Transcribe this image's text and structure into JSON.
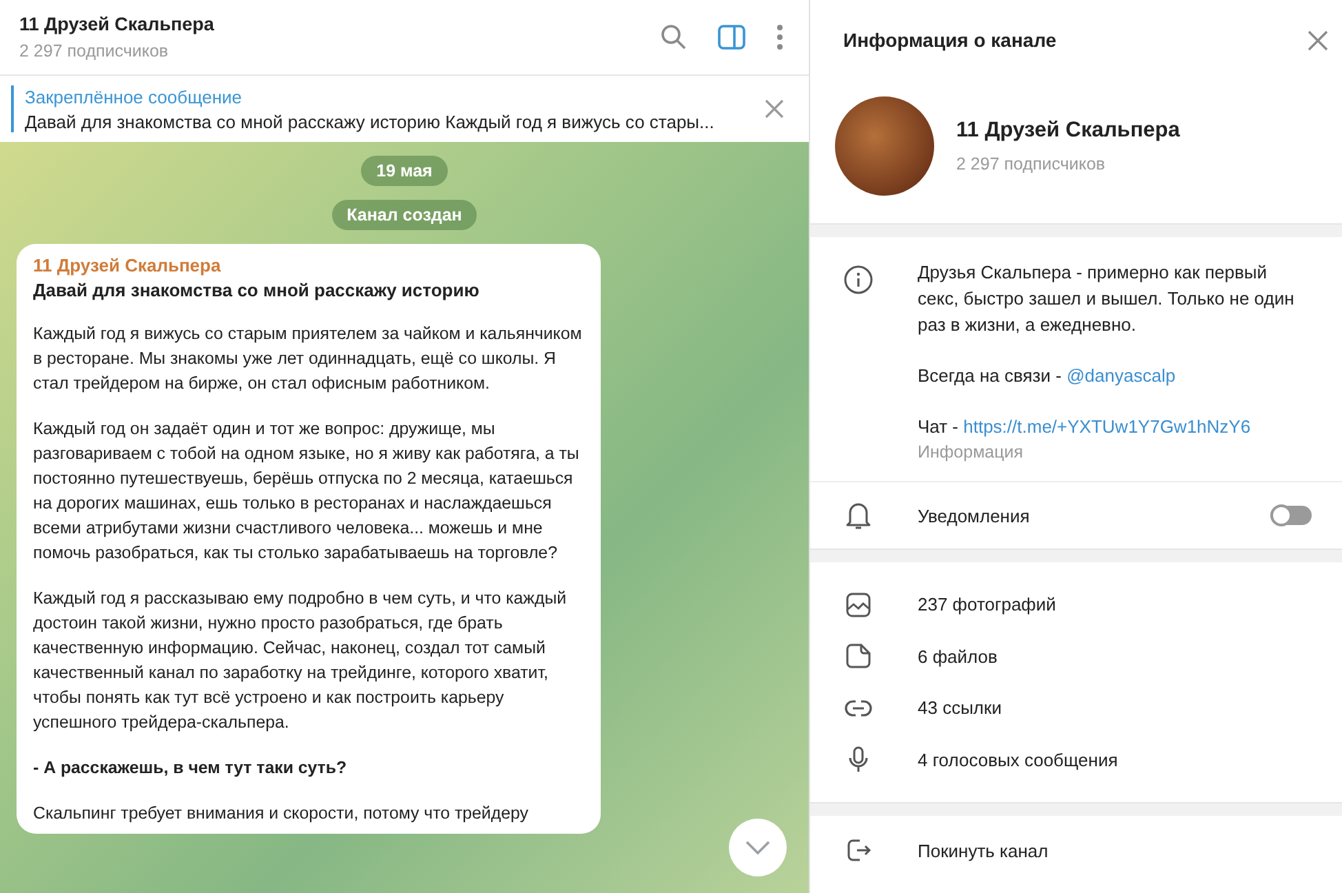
{
  "chat_header": {
    "title": "11 Друзей Скальпера",
    "subtitle": "2 297 подписчиков",
    "sidebar_toggle_on": true
  },
  "pinned": {
    "label": "Закреплённое сообщение",
    "text": "Давай для знакомства со мной расскажу историю  Каждый год я вижусь со стары..."
  },
  "service_messages": [
    "19 мая",
    "Канал создан"
  ],
  "message": {
    "author": "11 Друзей Скальпера",
    "title": "Давай для знакомства со мной расскажу историю",
    "paragraphs": [
      {
        "kind": "text",
        "text": "Каждый год я вижусь со старым приятелем за чайком и кальянчиком в ресторане. Мы знакомы уже лет одиннадцать, ещё со школы. Я стал трейдером на бирже, он стал офисным работником."
      },
      {
        "kind": "text",
        "text": "Каждый год он задаёт один и тот же вопрос: дружище, мы разговариваем с тобой на одном языке, но я живу как работяга, а ты постоянно путешествуешь, берёшь отпуска по 2 месяца, катаешься на дорогих машинах, ешь только в ресторанах и наслаждаешься всеми атрибутами жизни счастливого человека... можешь и мне помочь разобраться, как ты столько зарабатываешь на торговле?"
      },
      {
        "kind": "text",
        "text": "Каждый год я рассказываю ему подробно в чем суть, и что каждый достоин такой жизни, нужно просто разобраться, где брать качественную информацию. Сейчас, наконец, создал тот самый качественный канал по заработку на трейдинге, которого хватит, чтобы понять как тут всё устроено и как построить карьеру успешного трейдера-скальпера."
      },
      {
        "kind": "bold",
        "text": "- А расскажешь, в чем тут таки суть?"
      },
      {
        "kind": "text",
        "text": "Скальпинг требует внимания и скорости, потому что трейдеру"
      }
    ]
  },
  "info_panel": {
    "title": "Информация о канале",
    "name": "11 Друзей Скальпера",
    "subtitle": "2 297 подписчиков",
    "description": [
      {
        "text": "Друзья Скальпера - примерно как первый секс, быстро зашел и вышел. Только не один раз в жизни, а ежедневно."
      },
      {
        "text": "Всегда на связи - ",
        "link": "@danyascalp"
      },
      {
        "text": "Чат - ",
        "link": "https://t.me/+YXTUw1Y7Gw1hNzY6"
      }
    ],
    "description_caption": "Информация",
    "notifications": {
      "label": "Уведомления",
      "on": false
    },
    "media": [
      {
        "kind": "photos",
        "label": "237 фотографий"
      },
      {
        "kind": "files",
        "label": "6 файлов"
      },
      {
        "kind": "links",
        "label": "43 ссылки"
      },
      {
        "kind": "voice",
        "label": "4 голосовых сообщения"
      }
    ],
    "leave": "Покинуть канал"
  }
}
